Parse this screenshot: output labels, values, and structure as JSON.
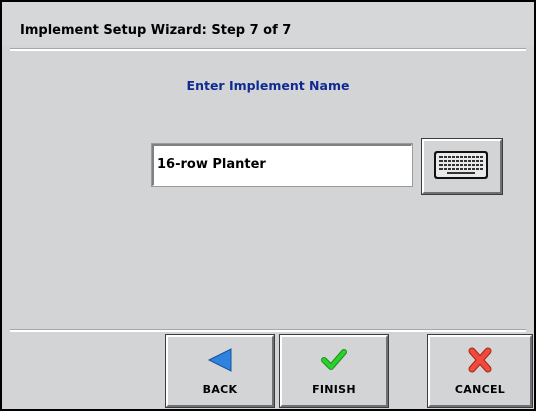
{
  "window": {
    "title": "Implement Setup Wizard:  Step 7 of 7"
  },
  "main": {
    "prompt": "Enter Implement Name",
    "name_input": {
      "value": "16-row Planter"
    }
  },
  "footer": {
    "back_label": "BACK",
    "finish_label": "FINISH",
    "cancel_label": "CANCEL"
  },
  "icons": {
    "keyboard": "keyboard-icon",
    "back": "left-arrow-icon",
    "finish": "checkmark-icon",
    "cancel": "x-icon"
  },
  "colors": {
    "prompt": "#112a92",
    "back_arrow": "#2f83e0",
    "finish_check": "#2bd12b",
    "cancel_x": "#f04a3a"
  }
}
